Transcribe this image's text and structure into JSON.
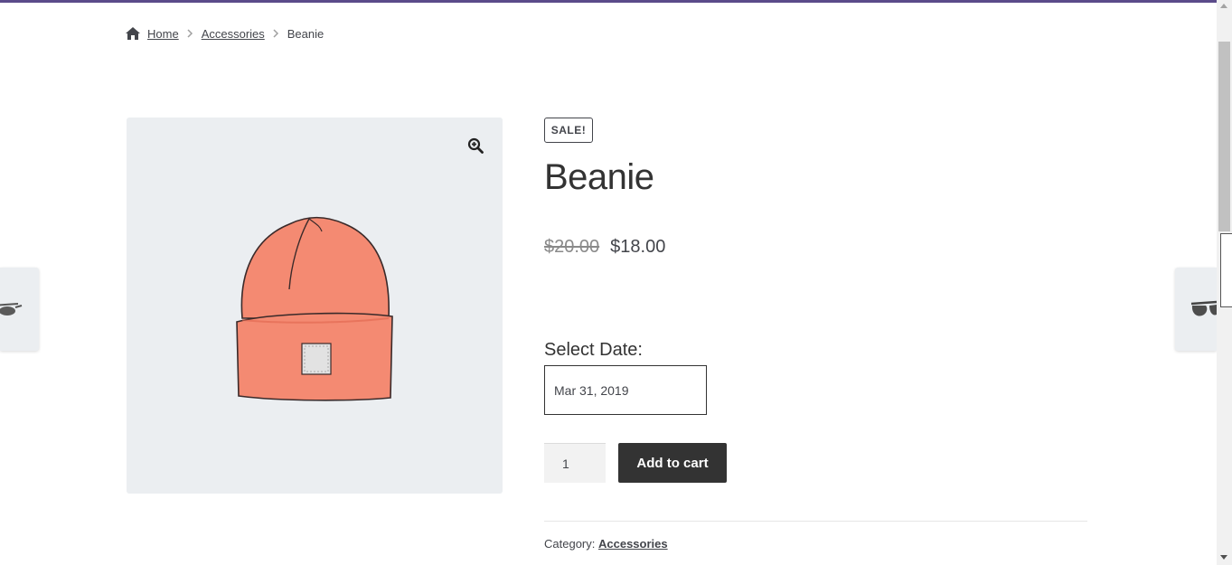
{
  "breadcrumb": {
    "home": "Home",
    "category": "Accessories",
    "current": "Beanie"
  },
  "product": {
    "badge": "SALE!",
    "title": "Beanie",
    "regular_price": "$20.00",
    "sale_price": "$18.00",
    "date_label": "Select Date:",
    "date_value": "Mar 31, 2019",
    "quantity": "1",
    "add_to_cart_label": "Add to cart",
    "category_label": "Category:",
    "category_value": "Accessories"
  },
  "colors": {
    "accent_bar": "#5b4b8a",
    "button_bg": "#333333",
    "gallery_bg": "#ebeef1",
    "beanie": "#f48a72"
  },
  "icons": {
    "home": "home-icon",
    "breadcrumb_separator": "chevron-right-icon",
    "zoom": "zoom-in-icon",
    "prev_product": "sunglasses-thumbnail",
    "next_product": "sunglasses-thumbnail"
  }
}
